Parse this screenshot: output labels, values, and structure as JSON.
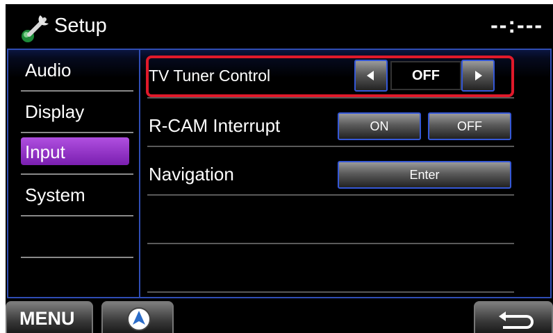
{
  "header": {
    "title": "Setup",
    "clock": "--:---",
    "settings_icon": "wrench-icon"
  },
  "sidebar": {
    "items": [
      {
        "label": "Audio",
        "active": false
      },
      {
        "label": "Display",
        "active": false
      },
      {
        "label": "Input",
        "active": true
      },
      {
        "label": "System",
        "active": false
      },
      {
        "label": "",
        "active": false
      }
    ]
  },
  "settings": {
    "tv_tuner": {
      "label": "TV Tuner Control",
      "value": "OFF",
      "prev_icon": "left-arrow-icon",
      "next_icon": "right-arrow-icon"
    },
    "rcam": {
      "label": "R-CAM Interrupt",
      "on_label": "ON",
      "off_label": "OFF"
    },
    "navigation": {
      "label": "Navigation",
      "enter_label": "Enter"
    }
  },
  "footer": {
    "menu_label": "MENU",
    "nav_icon": "navigation-icon",
    "back_icon": "return-arrow-icon"
  },
  "colors": {
    "accent": "#2f4db5",
    "active_item": "#9933cc",
    "highlight": "#e0192a"
  }
}
